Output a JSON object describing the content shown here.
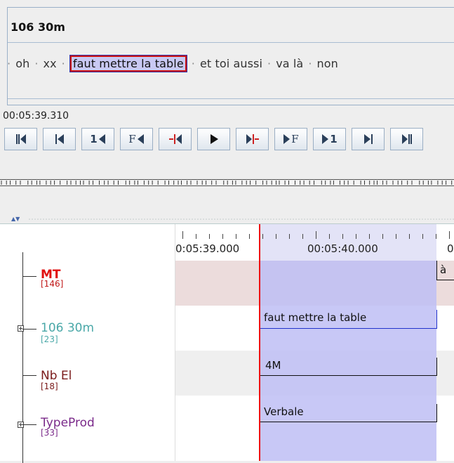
{
  "subtitle_viewer": {
    "tier_title": "106 30m",
    "segments": [
      {
        "text": "oh",
        "current": false
      },
      {
        "text": "xx",
        "current": false
      },
      {
        "text": "faut mettre la table",
        "current": true
      },
      {
        "text": "et toi aussi",
        "current": false
      },
      {
        "text": "va là",
        "current": false
      },
      {
        "text": "non",
        "current": false
      }
    ],
    "separator": "·"
  },
  "player": {
    "current_time": "00:05:39.310",
    "controls": [
      {
        "name": "go-to-begin-button",
        "label": "",
        "icon": "skip-to-start-icon"
      },
      {
        "name": "previous-frame-button",
        "label": "",
        "icon": "previous-icon"
      },
      {
        "name": "step-back-one-second-button",
        "label": "1",
        "icon": "step-back-icon"
      },
      {
        "name": "frame-back-button",
        "label": "F",
        "icon": "frame-back-icon"
      },
      {
        "name": "previous-boundary-button",
        "label": "",
        "icon": "boundary-back-icon"
      },
      {
        "name": "play-button",
        "label": "",
        "icon": "play-icon"
      },
      {
        "name": "next-boundary-button",
        "label": "",
        "icon": "boundary-forward-icon"
      },
      {
        "name": "frame-forward-button",
        "label": "F",
        "icon": "frame-forward-icon"
      },
      {
        "name": "step-forward-one-second-button",
        "label": "1",
        "icon": "step-forward-icon"
      },
      {
        "name": "next-frame-button",
        "label": "",
        "icon": "next-icon"
      },
      {
        "name": "go-to-end-button",
        "label": "",
        "icon": "skip-to-end-icon"
      }
    ]
  },
  "timeline": {
    "ruler_labels": [
      "0:05:39.000",
      "00:05:40.000",
      "0"
    ],
    "tiers": [
      {
        "name": "MT",
        "count": "[146]",
        "color": "#e01010",
        "bold": true,
        "expandable": false
      },
      {
        "name": "106 30m",
        "count": "[23]",
        "color": "#4aa8a8",
        "bold": false,
        "expandable": true
      },
      {
        "name": "Nb El",
        "count": "[18]",
        "color": "#7a1a1a",
        "bold": false,
        "expandable": false
      },
      {
        "name": "TypeProd",
        "count": "[33]",
        "color": "#7a2a8a",
        "bold": false,
        "expandable": true
      }
    ],
    "annotations": {
      "mt_right": "à",
      "tier_106": "faut mettre la table",
      "nb_el": "4M",
      "typeprod": "Verbale"
    }
  },
  "colors": {
    "accent": "#3333aa",
    "selection": "#c9c9f3",
    "playhead": "#e11111",
    "mt_row": "#ecdcdc"
  }
}
